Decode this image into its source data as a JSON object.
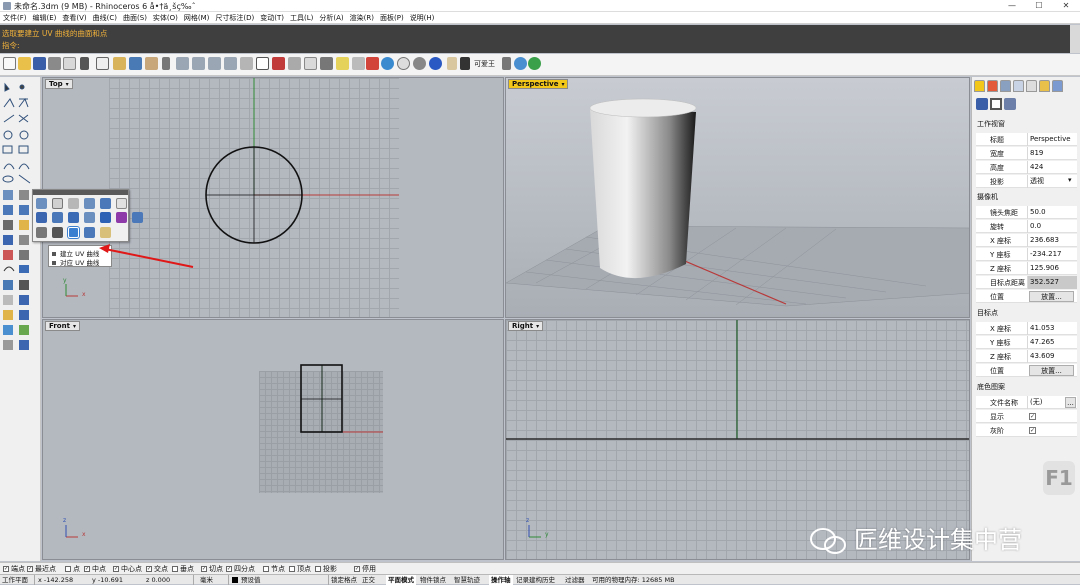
{
  "window": {
    "title": "未命名.3dm (9 MB) - Rhinoceros 6 å•†ä¸šç‰ˆ",
    "minimize": "—",
    "maximize": "☐",
    "close": "✕"
  },
  "menu": [
    "文件(F)",
    "编辑(E)",
    "查看(V)",
    "曲线(C)",
    "曲面(S)",
    "实体(O)",
    "网格(M)",
    "尺寸标注(D)",
    "变动(T)",
    "工具(L)",
    "分析(A)",
    "渲染(R)",
    "面板(P)",
    "说明(H)"
  ],
  "command": {
    "line1": "选取要建立 UV 曲线的曲面和点",
    "line2": "指令:"
  },
  "toolbar": {
    "text_label": "可爱王"
  },
  "viewports": {
    "top": {
      "label": "Top",
      "arrow": "▾"
    },
    "perspective": {
      "label": "Perspective",
      "arrow": "▾"
    },
    "front": {
      "label": "Front",
      "arrow": "▾"
    },
    "right": {
      "label": "Right",
      "arrow": "▾"
    }
  },
  "axes": {
    "x": "x",
    "y": "y",
    "z": "z"
  },
  "context_menu": {
    "item1": "建立 UV 曲线",
    "item2": "对应 UV 曲线"
  },
  "right_panel": {
    "section_view": "工作视窗",
    "rows_view": [
      {
        "k": "标题",
        "v": "Perspective"
      },
      {
        "k": "宽度",
        "v": "819"
      },
      {
        "k": "高度",
        "v": "424"
      },
      {
        "k": "投影",
        "v": "透视"
      }
    ],
    "section_camera": "摄像机",
    "rows_camera": [
      {
        "k": "镜头焦距",
        "v": "50.0"
      },
      {
        "k": "旋转",
        "v": "0.0"
      },
      {
        "k": "X 座标",
        "v": "236.683"
      },
      {
        "k": "Y 座标",
        "v": "-234.217"
      },
      {
        "k": "Z 座标",
        "v": "125.906"
      },
      {
        "k": "目标点距离",
        "v": "352.527"
      },
      {
        "k": "位置",
        "v": "放置..."
      }
    ],
    "section_target": "目标点",
    "rows_target": [
      {
        "k": "X 座标",
        "v": "41.053"
      },
      {
        "k": "Y 座标",
        "v": "47.265"
      },
      {
        "k": "Z 座标",
        "v": "43.609"
      },
      {
        "k": "位置",
        "v": "放置..."
      }
    ],
    "section_bg": "底色图案",
    "rows_bg": [
      {
        "k": "文件名称",
        "v": "(无)"
      },
      {
        "k": "显示",
        "v": "☑"
      },
      {
        "k": "灰阶",
        "v": "☑"
      }
    ],
    "browse_btn": "..."
  },
  "overlay": {
    "f1": "F1",
    "watermark": "匠维设计集中营"
  },
  "osnap": [
    "端点",
    "最近点",
    "点",
    "中点",
    "中心点",
    "交点",
    "垂点",
    "切点",
    "四分点",
    "节点",
    "顶点",
    "投影",
    "停用"
  ],
  "osnap_checked": [
    true,
    true,
    false,
    true,
    true,
    true,
    false,
    true,
    true,
    false,
    false,
    false,
    true
  ],
  "infobar": {
    "cplane": "工作平面",
    "x": "x -142.258",
    "y": "y -10.691",
    "z": "z 0.000",
    "unit": "毫米",
    "layer": "预设值",
    "items": [
      "锁定格点",
      "正交",
      "平面模式",
      "物件锁点",
      "智慧轨迹",
      "操作轴",
      "记录建构历史",
      "过滤器"
    ],
    "active": [
      "平面模式",
      "操作轴"
    ],
    "memory": "可用的物理内存: 12685 MB"
  },
  "colors": {
    "accent": "#f3c71a",
    "cmd_text": "#f2b23a",
    "x_axis": "#b83a3a",
    "y_axis": "#2f8a35",
    "arrow": "#e01818"
  }
}
